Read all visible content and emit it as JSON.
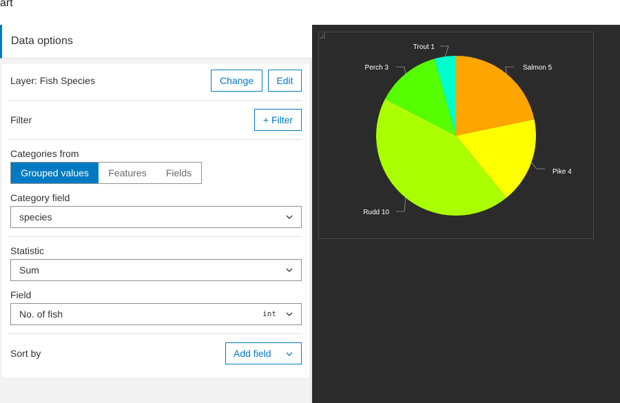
{
  "window": {
    "title_fragment": "art"
  },
  "panel": {
    "header": "Data options",
    "layer": {
      "label": "Layer: Fish Species",
      "change_label": "Change",
      "edit_label": "Edit"
    },
    "filter": {
      "label": "Filter",
      "button_label": "+ Filter"
    },
    "categories": {
      "label": "Categories from",
      "options": [
        "Grouped values",
        "Features",
        "Fields"
      ],
      "selected": "Grouped values"
    },
    "category_field": {
      "label": "Category field",
      "value": "species"
    },
    "statistic": {
      "label": "Statistic",
      "value": "Sum"
    },
    "field": {
      "label": "Field",
      "value": "No. of fish",
      "type_tag": "int"
    },
    "sort": {
      "label": "Sort by",
      "button_label": "Add field"
    }
  },
  "colors": {
    "accent": "#007ac2",
    "chart_background": "#2b2b2b"
  },
  "chart_data": {
    "type": "pie",
    "categories": [
      "Salmon",
      "Pike",
      "Rudd",
      "Perch",
      "Trout"
    ],
    "values": [
      5,
      4,
      10,
      3,
      1
    ],
    "colors": [
      "#ffa500",
      "#ffff00",
      "#aaff00",
      "#55ff00",
      "#00ffcc"
    ],
    "labels": [
      "Salmon 5",
      "Pike 4",
      "Rudd 10",
      "Perch 3",
      "Trout 1"
    ],
    "start_angle_deg": 0,
    "direction": "clockwise"
  }
}
